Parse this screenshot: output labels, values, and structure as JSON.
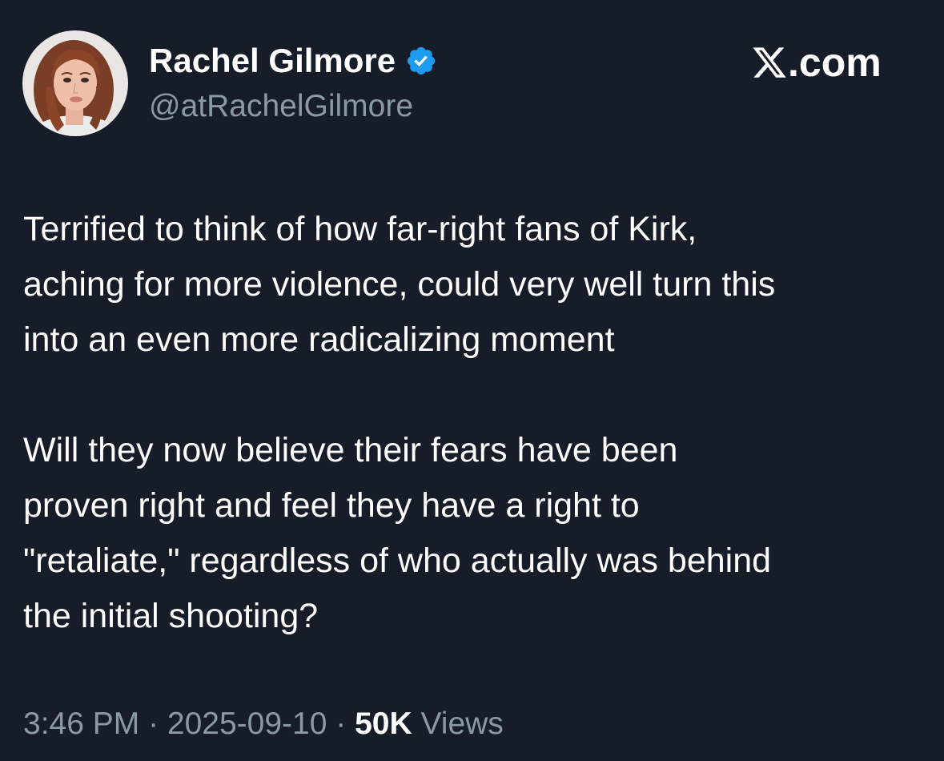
{
  "author": {
    "name": "Rachel Gilmore",
    "handle": "@atRachelGilmore",
    "verified": true
  },
  "brand": {
    "label": ".com",
    "icon": "x-logo-icon"
  },
  "tweet": {
    "paragraph1": [
      "Terrified to think of how far-right fans of Kirk,",
      "aching for more violence, could very well turn this",
      "into an even more radicalizing moment"
    ],
    "paragraph2": [
      "Will they now believe their fears have been",
      "proven right and feel they have a right to",
      "\"retaliate,\" regardless of who actually was behind",
      "the initial shooting?"
    ]
  },
  "meta": {
    "time": "3:46 PM",
    "separator": " · ",
    "date": "2025-09-10",
    "views_count": "50K",
    "views_label": " Views"
  },
  "colors": {
    "background": "#161d28",
    "text_primary": "#ffffff",
    "text_secondary": "#8b98a5",
    "verified_badge": "#1d9bf0"
  }
}
